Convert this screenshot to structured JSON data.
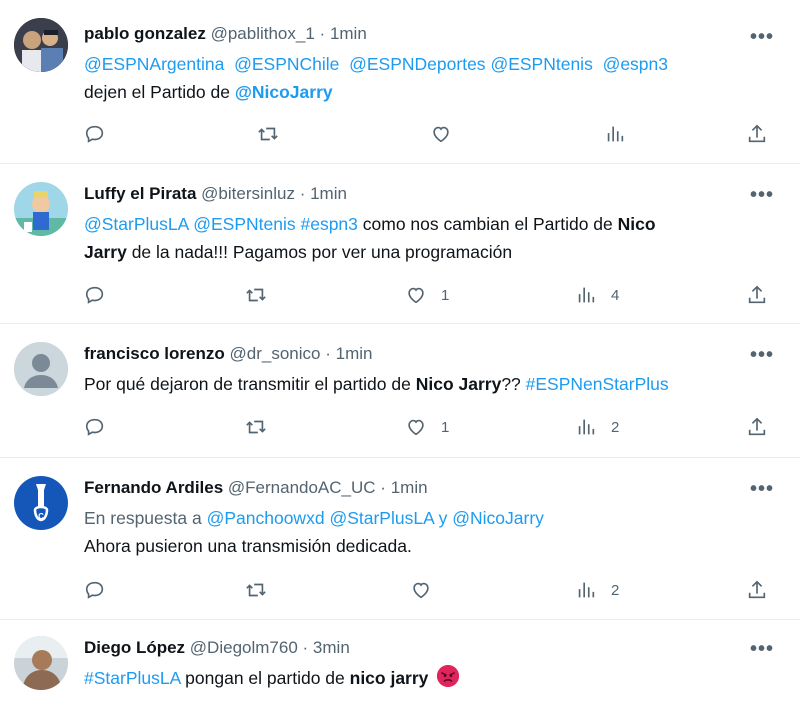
{
  "tweets": [
    {
      "name": "pablo gonzalez",
      "handle": "@pablithox_1",
      "dot": "·",
      "time": "1min",
      "line1": [
        "@ESPNArgentina",
        "@ESPNChile",
        "@ESPNDeportes",
        "@ESPNtenis",
        "@espn3"
      ],
      "line2_text": "dejen el Partido de ",
      "line2_link": "@NicoJarry",
      "likes": "",
      "views": ""
    },
    {
      "name": "Luffy el Pirata",
      "handle": "@bitersinluz",
      "dot": "·",
      "time": "1min",
      "l1_links": [
        "@StarPlusLA",
        "@ESPNtenis",
        "#espn3"
      ],
      "l1_text": " como nos cambian el Partido de ",
      "l1_bold": "Nico",
      "l2_bold": "Jarry",
      "l2_text": " de la nada!!! Pagamos por ver una programación",
      "likes": "1",
      "views": "4"
    },
    {
      "name": "francisco lorenzo",
      "handle": "@dr_sonico",
      "dot": "·",
      "time": "1min",
      "text1": "Por qué dejaron de transmitir el partido de ",
      "bold": "Nico Jarry",
      "text2": "?? ",
      "link": "#ESPNenStarPlus",
      "likes": "1",
      "views": "2"
    },
    {
      "name": "Fernando Ardiles",
      "handle": "@FernandoAC_UC",
      "dot": "·",
      "time": "1min",
      "reply_prefix": "En respuesta a ",
      "reply_links": [
        "@Panchoowxd",
        "@StarPlusLA"
      ],
      "reply_y": " y ",
      "reply_last": "@NicoJarry",
      "text": "Ahora pusieron una transmisión dedicada.",
      "likes": "",
      "views": "2"
    },
    {
      "name": "Diego López",
      "handle": "@Diegolm760",
      "dot": "·",
      "time": "3min",
      "link": "#StarPlusLA",
      "text": " pongan el partido de ",
      "bold": "nico jarry",
      "emoji": "angry-face-icon"
    }
  ],
  "more_label": "•••",
  "colors": {
    "link": "#1d9bf0",
    "muted": "#536471",
    "text": "#0f1419",
    "divider": "#e6ecf0"
  }
}
